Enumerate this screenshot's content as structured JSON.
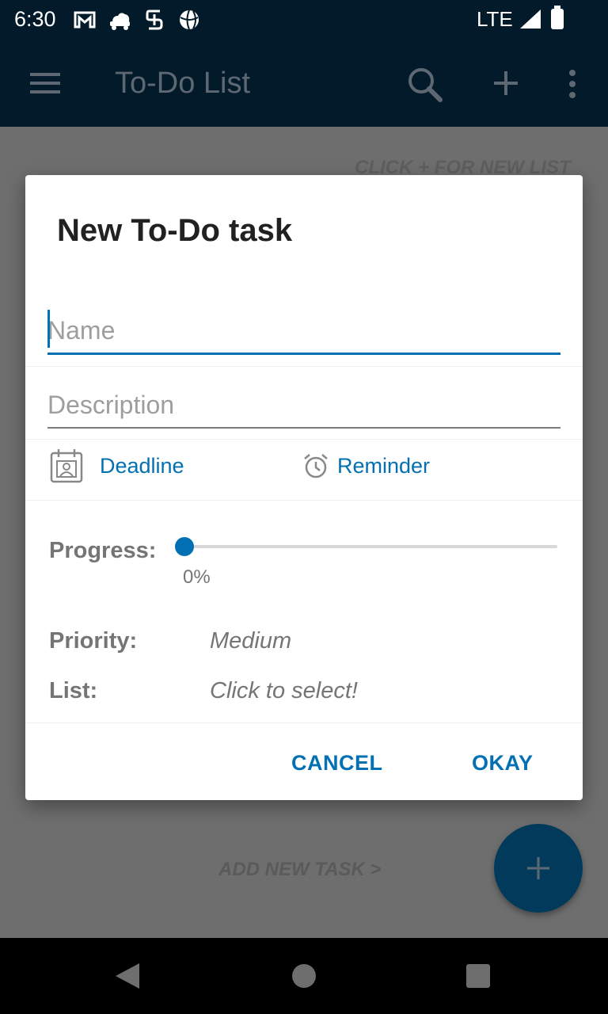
{
  "status_bar": {
    "time": "6:30",
    "network": "LTE",
    "icons": [
      "gmail-icon",
      "cloud-car-icon",
      "sync-icon",
      "sports-ball-icon",
      "signal-icon",
      "battery-icon"
    ]
  },
  "app_bar": {
    "title": "To-Do List",
    "icons": [
      "menu-icon",
      "search-icon",
      "add-icon",
      "more-vert-icon"
    ]
  },
  "background": {
    "hint": "CLICK + FOR NEW LIST",
    "add_task": "ADD NEW TASK >"
  },
  "dialog": {
    "title": "New To-Do task",
    "name": {
      "value": "",
      "placeholder": "Name"
    },
    "description": {
      "value": "",
      "placeholder": "Description"
    },
    "deadline_label": "Deadline",
    "reminder_label": "Reminder",
    "progress": {
      "label": "Progress:",
      "value_text": "0%",
      "value": 0
    },
    "priority": {
      "label": "Priority:",
      "value": "Medium"
    },
    "list": {
      "label": "List:",
      "value": "Click to select!"
    },
    "cancel_label": "CANCEL",
    "okay_label": "OKAY"
  },
  "colors": {
    "accent": "#0270b2",
    "status_bar": "#021a29",
    "overlay": "#6e6e6e",
    "fab": "#023a5c"
  }
}
